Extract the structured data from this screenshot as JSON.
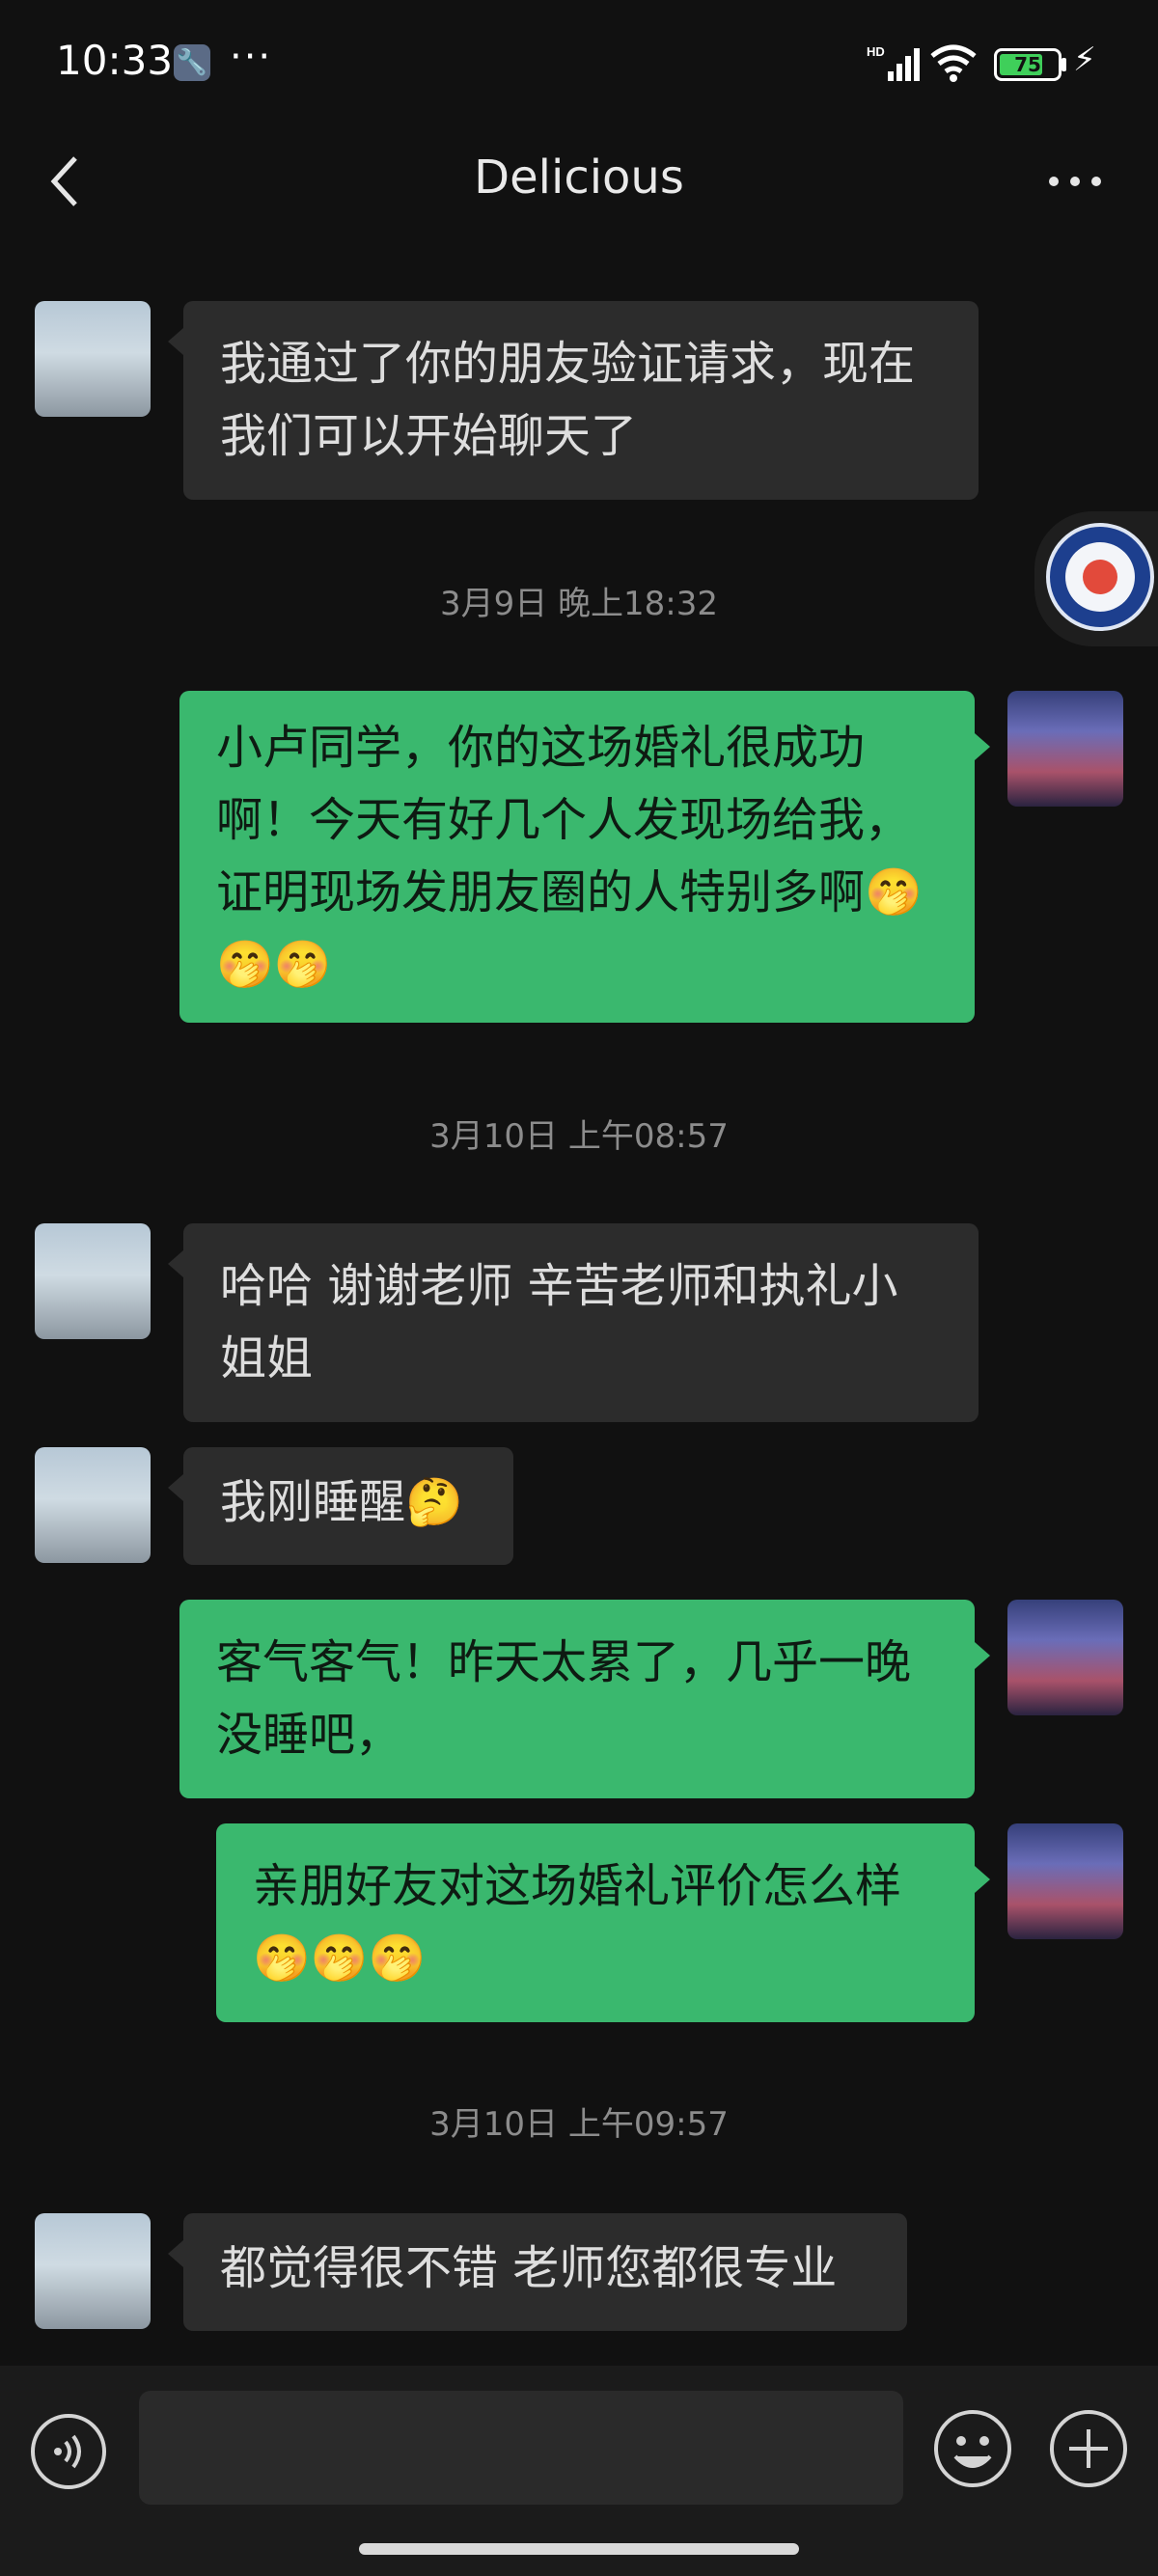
{
  "status_bar": {
    "time": "10:33",
    "battery_level": "75",
    "battery_percent": 75,
    "icons": [
      "wrench-icon",
      "more-dots-icon",
      "hd-signal-icon",
      "wifi-icon",
      "battery-icon",
      "charging-bolt-icon"
    ]
  },
  "header": {
    "title": "Delicious",
    "back_icon": "chevron-left-icon",
    "more_icon": "more-horizontal-icon"
  },
  "messages": [
    {
      "side": "in",
      "text": "我通过了你的朋友验证请求，现在我们可以开始聊天了"
    },
    {
      "type": "timestamp",
      "text": "3月9日 晚上18:32"
    },
    {
      "side": "out",
      "text": "小卢同学，你的这场婚礼很成功啊！今天有好几个人发现场给我，证明现场发朋友圈的人特别多啊🤭🤭🤭"
    },
    {
      "type": "timestamp",
      "text": "3月10日 上午08:57"
    },
    {
      "side": "in",
      "text": "哈哈 谢谢老师 辛苦老师和执礼小姐姐"
    },
    {
      "side": "in",
      "text": "我刚睡醒🤔"
    },
    {
      "side": "out",
      "text": "客气客气！昨天太累了，几乎一晚没睡吧，"
    },
    {
      "side": "out",
      "text": "亲朋好友对这场婚礼评价怎么样🤭🤭🤭"
    },
    {
      "type": "timestamp",
      "text": "3月10日 上午09:57"
    },
    {
      "side": "in",
      "text": "都觉得很不错 老师您都很专业"
    }
  ],
  "input_bar": {
    "placeholder": "",
    "voice_icon": "voice-icon",
    "emoji_icon": "emoji-icon",
    "plus_icon": "plus-icon"
  },
  "colors": {
    "background": "#111111",
    "incoming_bubble": "#2c2c2c",
    "outgoing_bubble": "#3ab86e",
    "timestamp_text": "#8c8c8c"
  }
}
